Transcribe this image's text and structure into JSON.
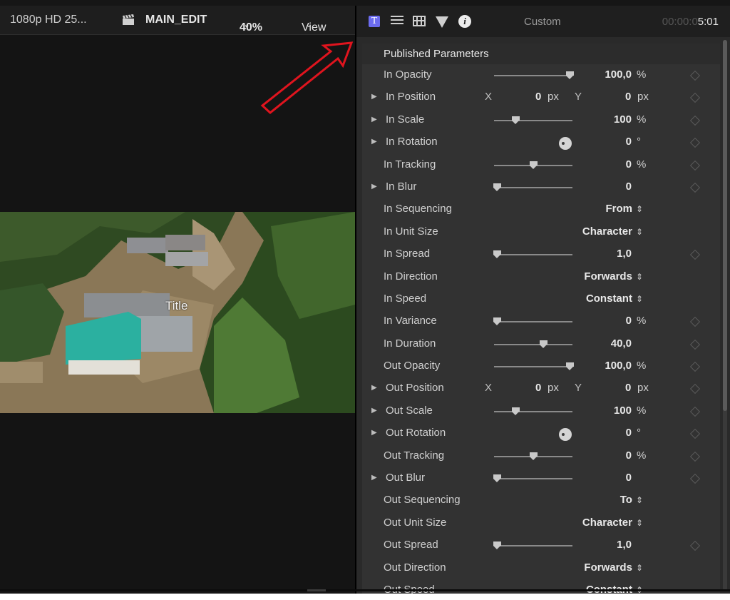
{
  "viewer": {
    "format": "1080p HD 25...",
    "project": "MAIN_EDIT",
    "zoom": "40%",
    "view_label": "View",
    "title_overlay": "Title"
  },
  "inspector": {
    "t_tab_glyph": "T",
    "info_glyph": "i",
    "title": "Custom",
    "timecode_dim": "00:00:0",
    "timecode_bright": "5:01",
    "section_header": "Published Parameters"
  },
  "params": [
    {
      "name": "In Opacity",
      "type": "slider",
      "pos": 0.96,
      "value": "100,0",
      "unit": "%",
      "keyframe": true
    },
    {
      "name": "In Position",
      "type": "xy",
      "disclosure": true,
      "x_label": "X",
      "x": "0",
      "x_unit": "px",
      "y_label": "Y",
      "y": "0",
      "y_unit": "px",
      "keyframe": true
    },
    {
      "name": "In Scale",
      "type": "slider",
      "disclosure": true,
      "pos": 0.27,
      "value": "100",
      "unit": "%",
      "keyframe": true
    },
    {
      "name": "In Rotation",
      "type": "dial",
      "disclosure": true,
      "value": "0",
      "unit": "°",
      "keyframe": true
    },
    {
      "name": "In Tracking",
      "type": "slider",
      "pos": 0.5,
      "value": "0",
      "unit": "%",
      "keyframe": true
    },
    {
      "name": "In Blur",
      "type": "slider",
      "disclosure": true,
      "pos": 0.04,
      "value": "0",
      "unit": "",
      "keyframe": true
    },
    {
      "name": "In Sequencing",
      "type": "popup",
      "value": "From",
      "keyframe": false
    },
    {
      "name": "In Unit Size",
      "type": "popup",
      "value": "Character",
      "keyframe": false
    },
    {
      "name": "In Spread",
      "type": "slider",
      "pos": 0.04,
      "value": "1,0",
      "unit": "",
      "keyframe": true
    },
    {
      "name": "In Direction",
      "type": "popup",
      "value": "Forwards",
      "keyframe": false
    },
    {
      "name": "In Speed",
      "type": "popup",
      "value": "Constant",
      "keyframe": false
    },
    {
      "name": "In Variance",
      "type": "slider",
      "pos": 0.04,
      "value": "0",
      "unit": "%",
      "keyframe": true
    },
    {
      "name": "In Duration",
      "type": "slider",
      "pos": 0.63,
      "value": "40,0",
      "unit": "",
      "keyframe": true
    },
    {
      "name": "Out Opacity",
      "type": "slider",
      "pos": 0.96,
      "value": "100,0",
      "unit": "%",
      "keyframe": true
    },
    {
      "name": "Out Position",
      "type": "xy",
      "disclosure": true,
      "x_label": "X",
      "x": "0",
      "x_unit": "px",
      "y_label": "Y",
      "y": "0",
      "y_unit": "px",
      "keyframe": true
    },
    {
      "name": "Out Scale",
      "type": "slider",
      "disclosure": true,
      "pos": 0.27,
      "value": "100",
      "unit": "%",
      "keyframe": true
    },
    {
      "name": "Out Rotation",
      "type": "dial",
      "disclosure": true,
      "value": "0",
      "unit": "°",
      "keyframe": true
    },
    {
      "name": "Out Tracking",
      "type": "slider",
      "pos": 0.5,
      "value": "0",
      "unit": "%",
      "keyframe": true
    },
    {
      "name": "Out Blur",
      "type": "slider",
      "disclosure": true,
      "pos": 0.04,
      "value": "0",
      "unit": "",
      "keyframe": true
    },
    {
      "name": "Out Sequencing",
      "type": "popup",
      "value": "To",
      "keyframe": false
    },
    {
      "name": "Out Unit Size",
      "type": "popup",
      "value": "Character",
      "keyframe": false
    },
    {
      "name": "Out Spread",
      "type": "slider",
      "pos": 0.04,
      "value": "1,0",
      "unit": "",
      "keyframe": true
    },
    {
      "name": "Out Direction",
      "type": "popup",
      "value": "Forwards",
      "keyframe": false
    },
    {
      "name": "Out Speed",
      "type": "popup",
      "value": "Constant",
      "keyframe": false
    }
  ],
  "colors": {
    "accent_tab": "#6c6cf0",
    "annotation_arrow": "#e0141e",
    "roof_green": "#2bb0a0"
  }
}
